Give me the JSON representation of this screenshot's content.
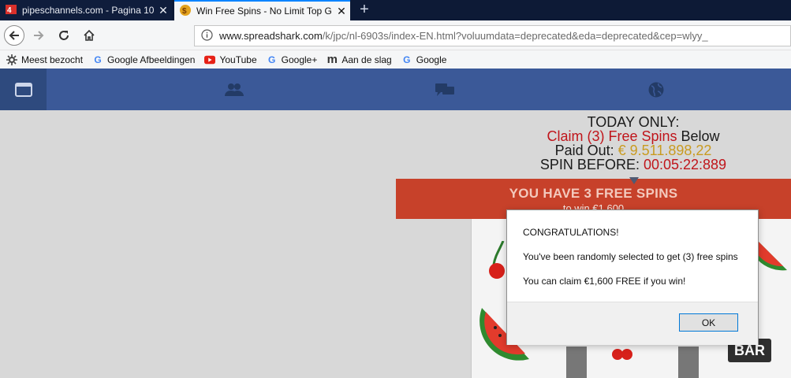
{
  "tabs": [
    {
      "title": "pipeschannels.com - Pagina 10",
      "close": "✕"
    },
    {
      "title": "Win Free Spins - No Limit Top G",
      "close": "✕"
    }
  ],
  "new_tab": "+",
  "url": {
    "domain": "www.spreadshark.com",
    "path": "/k/jpc/nl-6903s/index-EN.html?voluumdata=deprecated&eda=deprecated&cep=wlyy_"
  },
  "bookmarks": [
    {
      "label": "Meest bezocht",
      "icon": "gear-icon"
    },
    {
      "label": "Google Afbeeldingen",
      "icon": "google-icon"
    },
    {
      "label": "YouTube",
      "icon": "youtube-icon"
    },
    {
      "label": "Google+",
      "icon": "google-icon"
    },
    {
      "label": "Aan de slag",
      "icon": "m-icon"
    },
    {
      "label": "Google",
      "icon": "google-icon"
    }
  ],
  "promo": {
    "today": "TODAY ONLY:",
    "claim": "Claim (3) Free Spins",
    "below": " Below",
    "paid_label": "Paid Out: ",
    "paid_value": "€ 9.511.898,22",
    "spin_label": "SPIN BEFORE: ",
    "spin_value": "00:05:22:889"
  },
  "banner": {
    "heading": "YOU HAVE 3 FREE SPINS",
    "sub": "to win €1,600"
  },
  "slot": {
    "bar_label": "BAR"
  },
  "dialog": {
    "line1": "CONGRATULATIONS!",
    "line2": "You've been randomly selected to get (3) free spins",
    "line3": "You can claim €1,600 FREE if you win!",
    "ok": "OK"
  },
  "colors": {
    "site_nav": "#3b5998",
    "banner": "#c7412a",
    "red_text": "#c0151b",
    "gold_text": "#c99b21"
  }
}
